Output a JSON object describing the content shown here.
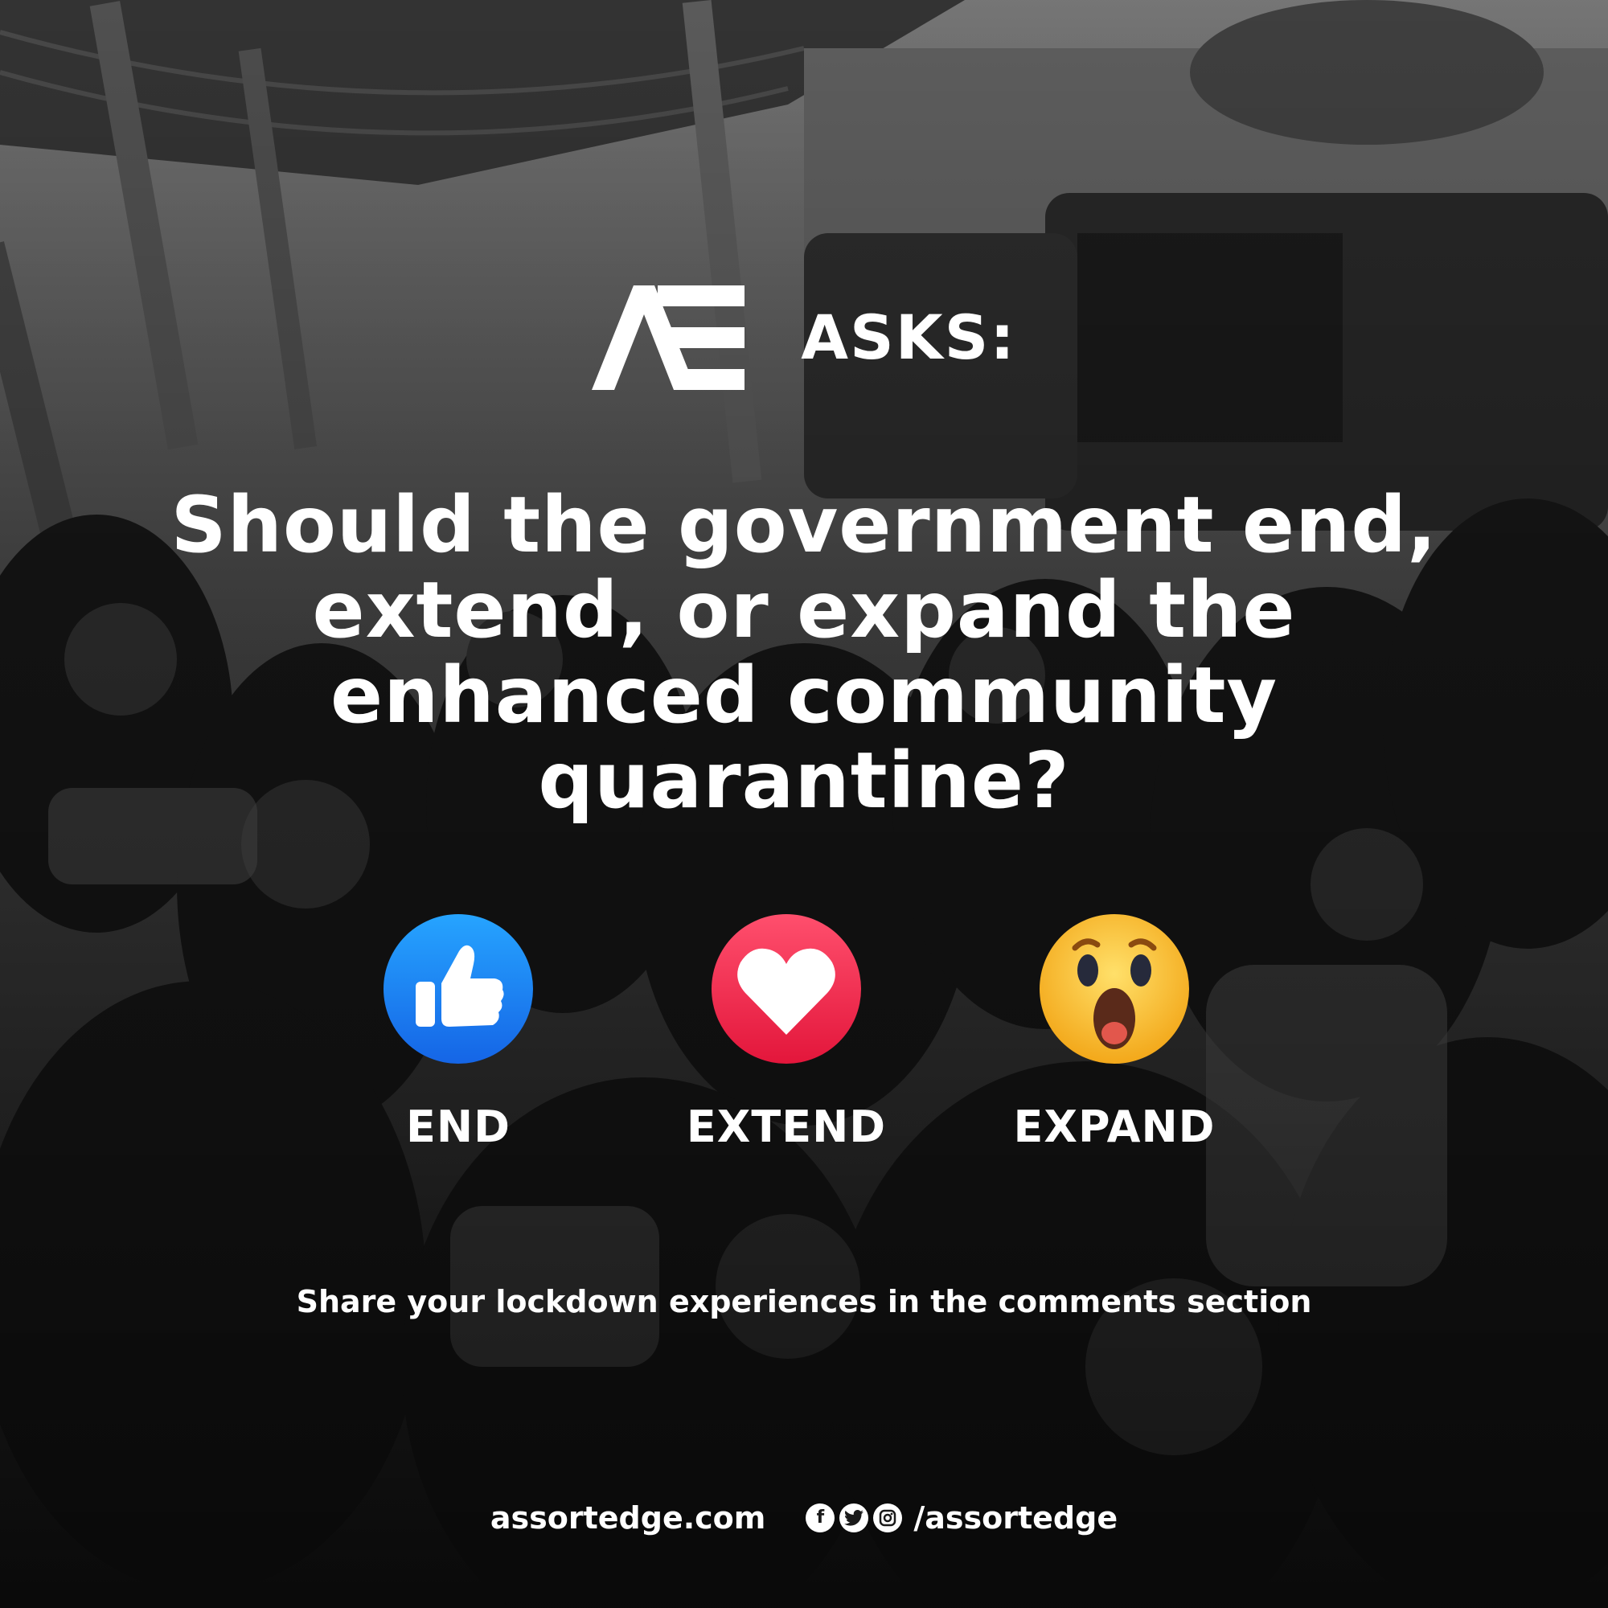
{
  "header": {
    "logo_text": "AE",
    "asks_label": "ASKS:"
  },
  "question": "Should the government end, extend, or expand the enhanced community quarantine?",
  "reactions": [
    {
      "icon": "like-icon",
      "label": "END",
      "color": "#1877f2"
    },
    {
      "icon": "love-icon",
      "label": "EXTEND",
      "color": "#f0284a"
    },
    {
      "icon": "wow-icon",
      "label": "EXPAND",
      "color": "#f7b125"
    }
  ],
  "share_text": "Share your lockdown experiences in the comments section",
  "footer": {
    "website": "assortedge.com",
    "social_icons": [
      "facebook-icon",
      "twitter-icon",
      "instagram-icon"
    ],
    "handle": "/assortedge"
  }
}
